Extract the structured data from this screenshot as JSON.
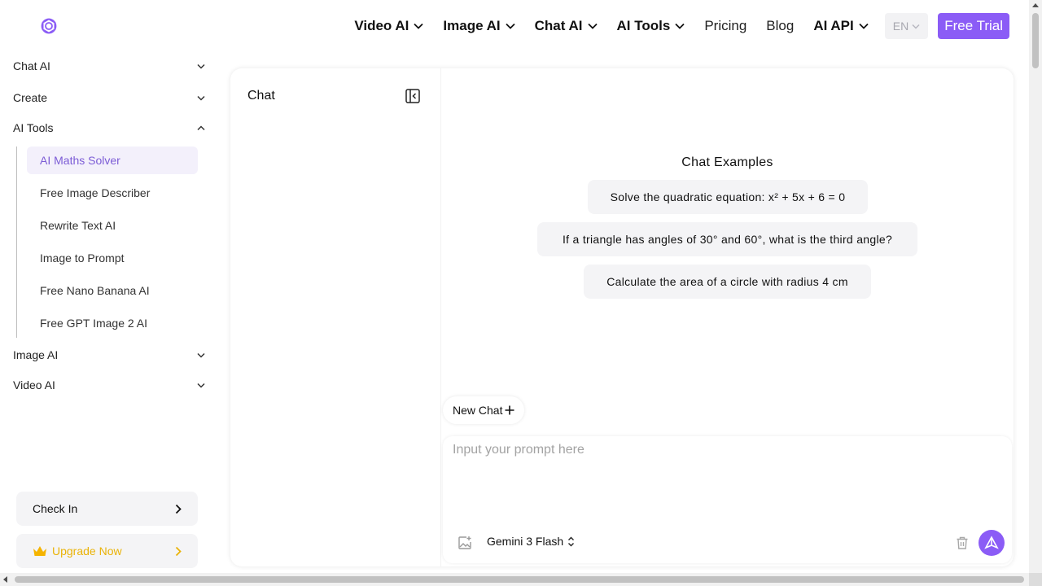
{
  "header": {
    "nav": [
      {
        "label": "Video AI",
        "dropdown": true
      },
      {
        "label": "Image AI",
        "dropdown": true
      },
      {
        "label": "Chat AI",
        "dropdown": true
      },
      {
        "label": "AI Tools",
        "dropdown": true
      },
      {
        "label": "Pricing",
        "dropdown": false
      },
      {
        "label": "Blog",
        "dropdown": false
      },
      {
        "label": "AI API",
        "dropdown": true
      }
    ],
    "language": "EN",
    "trial_label": "Free Trial"
  },
  "sidebar": {
    "groups": [
      {
        "label": "Chat AI",
        "expanded": false
      },
      {
        "label": "Create",
        "expanded": false
      },
      {
        "label": "AI Tools",
        "expanded": true
      },
      {
        "label": "Image AI",
        "expanded": false
      },
      {
        "label": "Video AI",
        "expanded": false
      }
    ],
    "ai_tools_items": [
      {
        "label": "AI Maths Solver",
        "active": true
      },
      {
        "label": "Free Image Describer",
        "active": false
      },
      {
        "label": "Rewrite Text AI",
        "active": false
      },
      {
        "label": "Image to Prompt",
        "active": false
      },
      {
        "label": "Free Nano Banana AI",
        "active": false
      },
      {
        "label": "Free GPT Image 2 AI",
        "active": false
      }
    ],
    "check_in_label": "Check In",
    "upgrade_label": "Upgrade Now"
  },
  "chat": {
    "panel_title": "Chat",
    "examples_title": "Chat Examples",
    "examples": [
      "Solve the quadratic equation: x² + 5x + 6 = 0",
      "If a triangle has angles of 30° and 60°, what is the third angle?",
      "Calculate the area of a circle with radius 4 cm"
    ],
    "new_chat_label": "New Chat",
    "prompt_placeholder": "Input your prompt here",
    "prompt_value": "",
    "model": "Gemini 3 Flash"
  },
  "colors": {
    "accent": "#8b5cf6",
    "active_bg": "#f3f0fb",
    "active_text": "#7c5cd6",
    "upgrade": "#eab308"
  }
}
